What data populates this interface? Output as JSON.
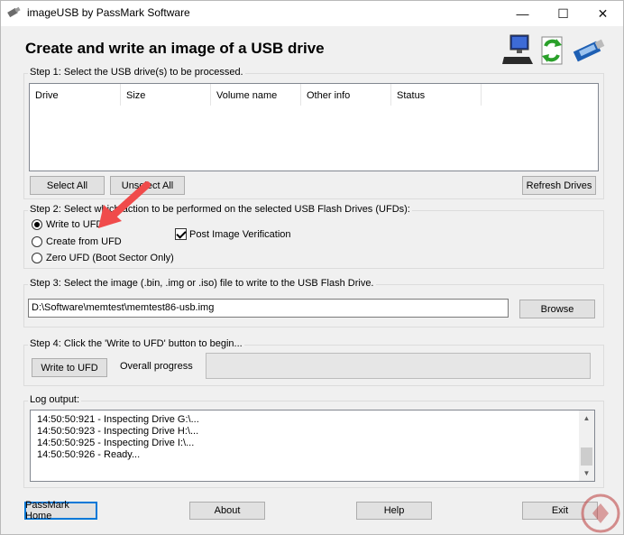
{
  "window": {
    "title": "imageUSB by PassMark Software",
    "minimize": "—",
    "maximize": "☐",
    "close": "✕"
  },
  "header": {
    "heading": "Create and write an image of a USB drive",
    "icons": [
      "computer-icon",
      "refresh-document-icon",
      "usb-drive-icon"
    ]
  },
  "step1": {
    "label": "Step 1: Select the USB drive(s) to be processed.",
    "columns": [
      "Drive",
      "Size",
      "Volume name",
      "Other info",
      "Status"
    ],
    "select_all": "Select All",
    "unselect_all": "Unselect All",
    "refresh_drives": "Refresh Drives"
  },
  "step2": {
    "label": "Step 2: Select which action to be performed on the selected USB Flash Drives (UFDs):",
    "options": [
      {
        "label": "Write to UFD",
        "checked": true
      },
      {
        "label": "Create from UFD",
        "checked": false
      },
      {
        "label": "Zero UFD (Boot Sector Only)",
        "checked": false
      }
    ],
    "post_verify_label": "Post Image Verification",
    "post_verify_checked": true
  },
  "step3": {
    "label": "Step 3: Select the image (.bin, .img or .iso) file to write to the USB Flash Drive.",
    "path_value": "D:\\Software\\memtest\\memtest86-usb.img",
    "browse": "Browse"
  },
  "step4": {
    "label": "Step 4: Click the 'Write to UFD' button to begin...",
    "write_button": "Write to UFD",
    "progress_label": "Overall progress",
    "progress_value": 0
  },
  "log": {
    "label": "Log output:",
    "lines": [
      "14:50:50:921 - Inspecting Drive G:\\...",
      "14:50:50:923 - Inspecting Drive H:\\...",
      "14:50:50:925 - Inspecting Drive I:\\...",
      "14:50:50:926 - Ready..."
    ]
  },
  "footer": {
    "passmark_home": "PassMark Home",
    "about": "About",
    "help": "Help",
    "exit": "Exit"
  },
  "annotation": {
    "arrow_color": "#f04b4b"
  }
}
